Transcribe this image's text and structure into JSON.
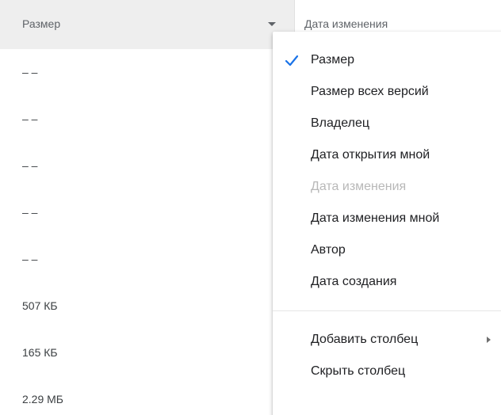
{
  "header": {
    "size_column": "Размер",
    "date_column": "Дата изменения"
  },
  "rows": [
    {
      "size": "– –"
    },
    {
      "size": "– –"
    },
    {
      "size": "– –"
    },
    {
      "size": "– –"
    },
    {
      "size": "– –"
    },
    {
      "size": "507 КБ"
    },
    {
      "size": "165 КБ"
    },
    {
      "size": "2.29 МБ"
    }
  ],
  "menu": {
    "items": [
      {
        "label": "Размер",
        "checked": true
      },
      {
        "label": "Размер всех версий"
      },
      {
        "label": "Владелец"
      },
      {
        "label": "Дата открытия мной"
      },
      {
        "label": "Дата изменения",
        "disabled": true
      },
      {
        "label": "Дата изменения мной"
      },
      {
        "label": "Автор"
      },
      {
        "label": "Дата создания"
      }
    ],
    "add_column": "Добавить столбец",
    "hide_column": "Скрыть столбец"
  },
  "colors": {
    "check": "#1a73e8",
    "disabled_text": "#b8b8b8",
    "header_bg": "#eeeeee"
  }
}
